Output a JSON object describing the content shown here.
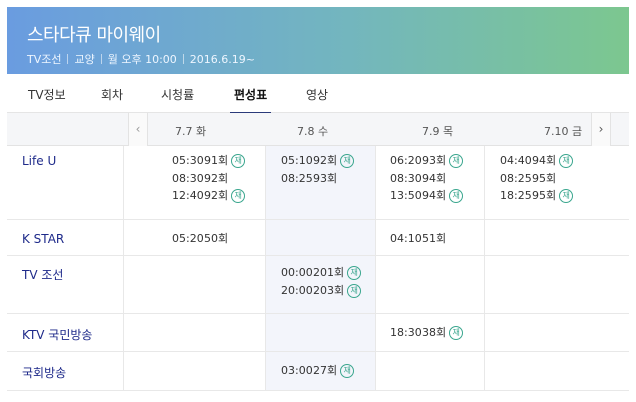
{
  "header": {
    "title": "스타다큐 마이웨이",
    "channel": "TV조선",
    "genre": "교양",
    "airtime": "월 오후 10:00",
    "start": "2016.6.19~"
  },
  "tabs": [
    "TV정보",
    "회차",
    "시청률",
    "편성표",
    "영상"
  ],
  "active_tab": "편성표",
  "dates": [
    "7.7 화",
    "7.8 수",
    "7.9 목",
    "7.10 금"
  ],
  "rerun_label": "재",
  "schedule": [
    {
      "channel": "Life U",
      "days": [
        [
          {
            "time": "05:30",
            "ep": "91회",
            "rerun": true
          },
          {
            "time": "08:30",
            "ep": "92회",
            "rerun": false
          },
          {
            "time": "12:40",
            "ep": "92회",
            "rerun": true
          }
        ],
        [
          {
            "time": "05:10",
            "ep": "92회",
            "rerun": true
          },
          {
            "time": "08:25",
            "ep": "93회",
            "rerun": false
          }
        ],
        [
          {
            "time": "06:20",
            "ep": "93회",
            "rerun": true
          },
          {
            "time": "08:30",
            "ep": "94회",
            "rerun": false
          },
          {
            "time": "13:50",
            "ep": "94회",
            "rerun": true
          }
        ],
        [
          {
            "time": "04:40",
            "ep": "94회",
            "rerun": true
          },
          {
            "time": "08:25",
            "ep": "95회",
            "rerun": false
          },
          {
            "time": "18:25",
            "ep": "95회",
            "rerun": true
          }
        ]
      ]
    },
    {
      "channel": "K STAR",
      "days": [
        [
          {
            "time": "05:20",
            "ep": "50회",
            "rerun": false
          }
        ],
        [],
        [
          {
            "time": "04:10",
            "ep": "51회",
            "rerun": false
          }
        ],
        []
      ]
    },
    {
      "channel": "TV 조선",
      "days": [
        [],
        [
          {
            "time": "00:00",
            "ep": "201회",
            "rerun": true
          },
          {
            "time": "20:00",
            "ep": "203회",
            "rerun": true
          }
        ],
        [],
        []
      ]
    },
    {
      "channel": "KTV 국민방송",
      "days": [
        [],
        [],
        [
          {
            "time": "18:30",
            "ep": "38회",
            "rerun": true
          }
        ],
        []
      ]
    },
    {
      "channel": "국회방송",
      "days": [
        [],
        [
          {
            "time": "03:00",
            "ep": "27회",
            "rerun": true
          }
        ],
        [],
        []
      ]
    }
  ],
  "colors": {
    "header_start": "#6a9ce0",
    "header_end": "#7cc78f",
    "channel_link": "#1e2a8a",
    "rerun_badge": "#3aa68e",
    "dots": [
      "#e84b3c",
      "#3aa68e",
      "#4a7bd0"
    ]
  }
}
